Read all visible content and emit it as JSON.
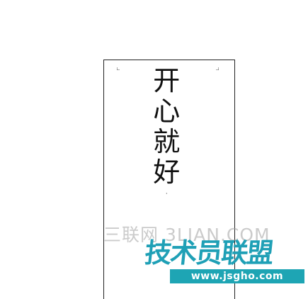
{
  "document": {
    "vertical_text": [
      "开",
      "心",
      "就",
      "好"
    ],
    "end_mark": "·"
  },
  "watermarks": {
    "site_cn": "三联网 3LIAN.COM",
    "brand": "技术员联盟",
    "url": "www.jsgho.com"
  },
  "colors": {
    "brand_teal": "#1ea5b4",
    "text": "#111111"
  }
}
